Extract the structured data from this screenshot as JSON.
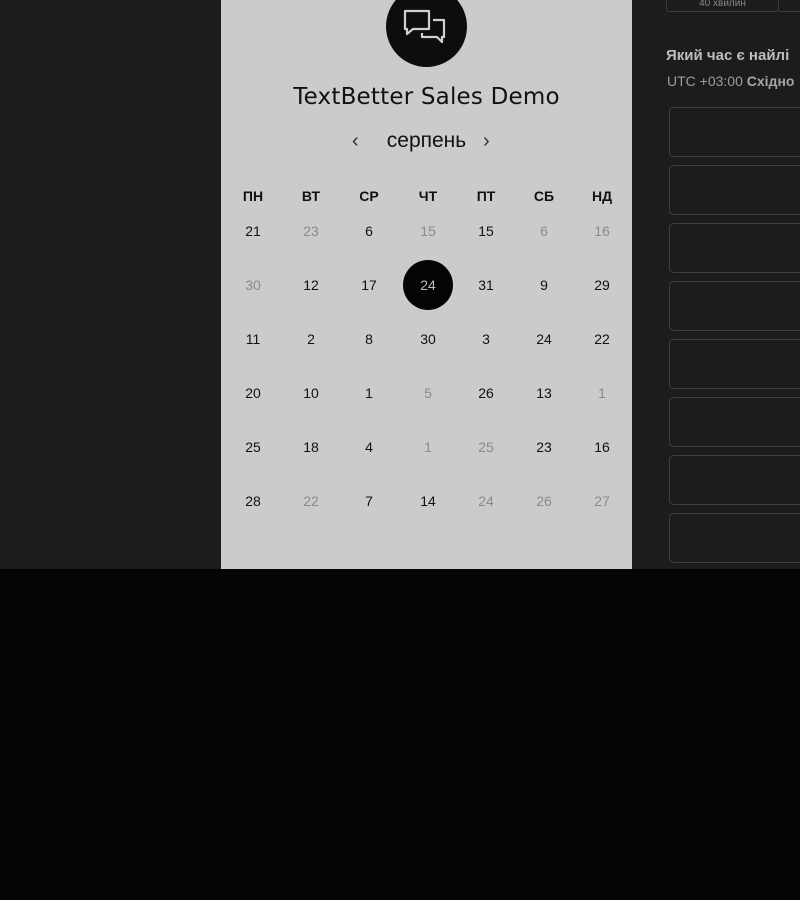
{
  "calendar": {
    "title": "TextBetter Sales Demo",
    "month": "серпень",
    "prev_icon": "‹",
    "next_icon": "›",
    "weekdays": [
      "ПН",
      "ВТ",
      "СР",
      "ЧТ",
      "ПТ",
      "СБ",
      "НД"
    ],
    "weeks": [
      [
        {
          "d": "21"
        },
        {
          "d": "23",
          "muted": true
        },
        {
          "d": "6"
        },
        {
          "d": "15",
          "muted": true
        },
        {
          "d": "15"
        },
        {
          "d": "6",
          "muted": true
        },
        {
          "d": "16",
          "muted": true
        }
      ],
      [
        {
          "d": "30",
          "muted": true
        },
        {
          "d": "12"
        },
        {
          "d": "17"
        },
        {
          "d": "24",
          "selected": true
        },
        {
          "d": "31"
        },
        {
          "d": "9"
        },
        {
          "d": "29"
        }
      ],
      [
        {
          "d": "11"
        },
        {
          "d": "2"
        },
        {
          "d": "8"
        },
        {
          "d": "30"
        },
        {
          "d": "3"
        },
        {
          "d": "24"
        },
        {
          "d": "22"
        }
      ],
      [
        {
          "d": "20"
        },
        {
          "d": "10"
        },
        {
          "d": "1"
        },
        {
          "d": "5",
          "muted": true
        },
        {
          "d": "26"
        },
        {
          "d": "13"
        },
        {
          "d": "1",
          "muted": true
        }
      ],
      [
        {
          "d": "25"
        },
        {
          "d": "18"
        },
        {
          "d": "4"
        },
        {
          "d": "1",
          "muted": true
        },
        {
          "d": "25",
          "muted": true
        },
        {
          "d": "23"
        },
        {
          "d": "16"
        }
      ],
      [
        {
          "d": "28"
        },
        {
          "d": "22",
          "muted": true
        },
        {
          "d": "7"
        },
        {
          "d": "14"
        },
        {
          "d": "24",
          "muted": true
        },
        {
          "d": "26",
          "muted": true
        },
        {
          "d": "27",
          "muted": true
        }
      ]
    ]
  },
  "right": {
    "duration_tab": "40 хвилин",
    "question": "Який час є найлі",
    "tz_offset": "UTC +03:00",
    "tz_name": "Східно",
    "slot_count": 8
  },
  "colors": {
    "card_bg": "#cbcbcb",
    "page_bg": "#1c1c1c",
    "selected_day_bg": "#050505",
    "muted_text": "#8a8a8a"
  }
}
